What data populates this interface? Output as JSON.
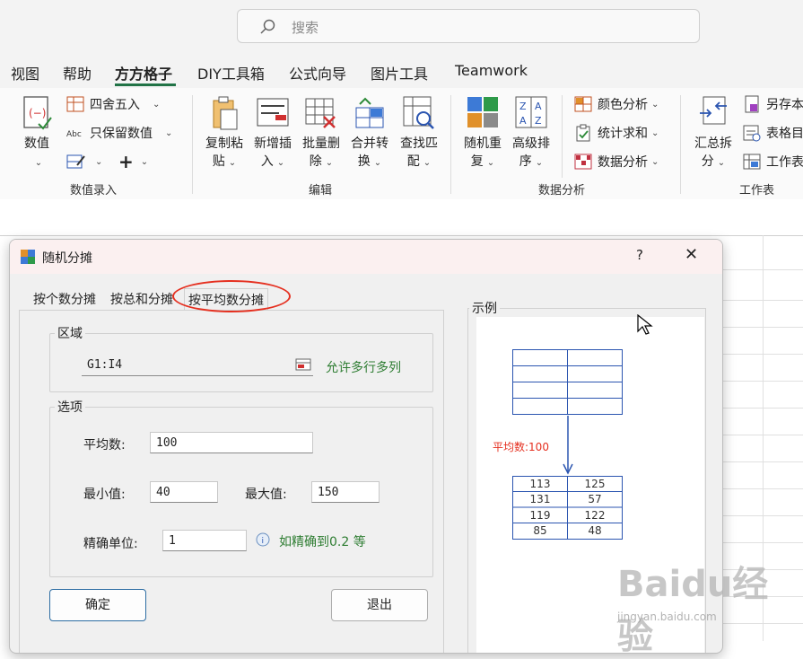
{
  "search": {
    "placeholder": "搜索"
  },
  "menu": {
    "items": [
      "视图",
      "帮助",
      "方方格子",
      "DIY工具箱",
      "公式向导",
      "图片工具",
      "Teamwork"
    ],
    "active_index": 2
  },
  "ribbon": {
    "groups": {
      "data_entry": "数值录入",
      "edit": "编辑",
      "data_analysis": "数据分析",
      "worksheet": "工作表"
    },
    "buttons": {
      "numeric_line1": "数值",
      "round": "四舍五入",
      "keep_value": "只保留数值",
      "copy_paste_line1": "复制粘",
      "copy_paste_line2": "贴",
      "insert_line1": "新增插",
      "insert_line2": "入",
      "batch_delete_line1": "批量删",
      "batch_delete_line2": "除",
      "merge_convert_line1": "合并转",
      "merge_convert_line2": "换",
      "find_match_line1": "查找匹",
      "find_match_line2": "配",
      "random_repeat_line1": "随机重",
      "random_repeat_line2": "复",
      "advanced_sort_line1": "高级排",
      "advanced_sort_line2": "序",
      "color_analysis": "颜色分析",
      "count_sum": "统计求和",
      "data_analysis": "数据分析",
      "summary_split_line1": "汇总拆",
      "summary_split_line2": "分",
      "save_as": "另存本",
      "table_dir": "表格目",
      "worksheet_tool": "工作表"
    }
  },
  "dialog": {
    "title": "随机分摊",
    "help": "?",
    "close": "✕",
    "tabs": [
      "按个数分摊",
      "按总和分摊",
      "按平均数分摊"
    ],
    "active_tab": 2,
    "region": {
      "legend": "区域",
      "value": "G1:I4",
      "hint": "允许多行多列"
    },
    "options": {
      "legend": "选项",
      "average_label": "平均数:",
      "average_value": "100",
      "min_label": "最小值:",
      "min_value": "40",
      "max_label": "最大值:",
      "max_value": "150",
      "precision_label": "精确单位:",
      "precision_value": "1",
      "precision_hint": "如精确到0.2 等"
    },
    "ok": "确定",
    "exit": "退出",
    "example": {
      "legend": "示例",
      "avg_label": "平均数:100",
      "result": [
        [
          "113",
          "125"
        ],
        [
          "131",
          "57"
        ],
        [
          "119",
          "122"
        ],
        [
          "85",
          "48"
        ]
      ]
    }
  },
  "watermark": {
    "text": "Baidu经验",
    "url": "jingyan.baidu.com"
  },
  "colors": {
    "accent_green": "#217346",
    "annotation_red": "#e53020",
    "hint_green": "#2e7d32",
    "example_blue": "#2b55b0"
  }
}
